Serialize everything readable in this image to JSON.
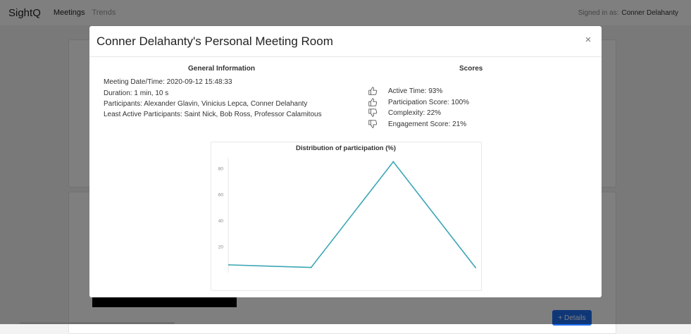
{
  "navbar": {
    "brand": "SightQ",
    "links": [
      "Meetings",
      "Trends"
    ],
    "signed_in_label": "Signed in as:",
    "signed_in_user": "Conner Delahanty"
  },
  "background": {
    "details_button": "+ Details"
  },
  "modal": {
    "title": "Conner Delahanty's Personal Meeting Room",
    "close_label": "×",
    "general_heading": "General Information",
    "scores_heading": "Scores",
    "info": [
      "Meeting Date/Time: 2020-09-12 15:48:33",
      "Duration: 1 min, 10 s",
      "Participants: Alexander Glavin, Vinicius Lepca, Conner Delahanty",
      "Least Active Participants: Saint Nick, Bob Ross, Professor Calamitous"
    ],
    "scores": [
      {
        "label": "Active Time: 93%",
        "icon": "thumbs-up-icon"
      },
      {
        "label": "Participation Score: 100%",
        "icon": "thumbs-up-icon"
      },
      {
        "label": "Complexity: 22%",
        "icon": "thumbs-down-icon"
      },
      {
        "label": "Engagement Score: 21%",
        "icon": "thumbs-down-icon"
      }
    ]
  },
  "chart_data": {
    "type": "line",
    "title": "Distribution of participation (%)",
    "xlabel": "",
    "ylabel": "",
    "x": [
      0,
      1,
      2,
      3
    ],
    "values": [
      6,
      4,
      85,
      4
    ],
    "yticks": [
      20,
      40,
      60,
      80
    ],
    "ylim": [
      0,
      88
    ],
    "color": "#3aa6b4",
    "grid": false
  },
  "colors": {
    "backdrop": "rgba(0,0,0,0.5)",
    "primary": "#1e6ff0",
    "line": "#3aa6b4"
  }
}
